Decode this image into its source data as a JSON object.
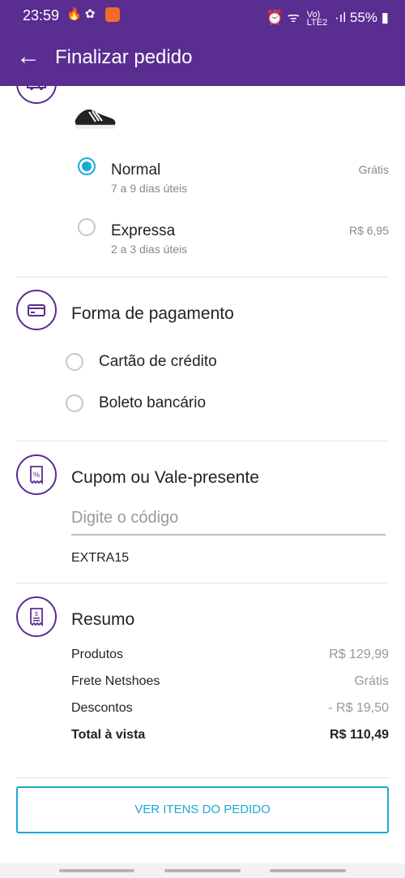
{
  "status_bar": {
    "time": "23:59",
    "left_icons": "🔥 ✿",
    "right_icons": "⏰ ᯤ",
    "network_top": "Vo)",
    "network_bottom": "LTE2",
    "signal": "·ıl",
    "battery_percent": "55%",
    "battery_icon": "▮"
  },
  "app_bar": {
    "back_icon": "←",
    "title": "Finalizar pedido"
  },
  "shipping": {
    "options": [
      {
        "title": "Normal",
        "subtitle": "7 a 9 dias úteis",
        "price": "Grátis",
        "selected": true
      },
      {
        "title": "Expressa",
        "subtitle": "2 a 3 dias úteis",
        "price": "R$ 6,95",
        "selected": false
      }
    ]
  },
  "payment": {
    "title": "Forma de pagamento",
    "options": [
      "Cartão de crédito",
      "Boleto bancário"
    ]
  },
  "coupon": {
    "title": "Cupom ou Vale-presente",
    "placeholder": "Digite o código",
    "applied_code": "EXTRA15"
  },
  "summary": {
    "title": "Resumo",
    "rows": [
      {
        "label": "Produtos",
        "value": "R$ 129,99"
      },
      {
        "label": "Frete Netshoes",
        "value": "Grátis"
      },
      {
        "label": "Descontos",
        "value": "- R$ 19,50"
      },
      {
        "label": "Total à vista",
        "value": "R$ 110,49"
      }
    ]
  },
  "button": {
    "view_items": "VER ITENS DO PEDIDO"
  },
  "colors": {
    "brand_purple": "#5a2d91",
    "accent_blue": "#1aa9d6"
  }
}
